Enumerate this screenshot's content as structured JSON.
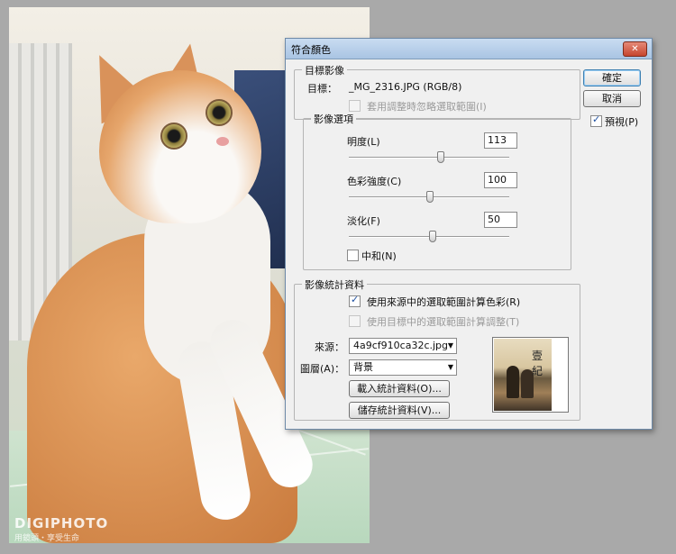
{
  "photo": {
    "watermark": "DIGIPHOTO",
    "watermark_sub": "用鏡頭・享受生命"
  },
  "dialog": {
    "title": "符合顏色",
    "close_glyph": "✕",
    "target_group": {
      "legend": "目標影像",
      "target_label": "目標：",
      "target_value": "_MG_2316.JPG (RGB/8)",
      "ignore_selection": {
        "label": "套用調整時忽略選取範圍(I)",
        "checked": false,
        "enabled": false
      }
    },
    "options_group": {
      "legend": "影像選項",
      "luminance": {
        "label": "明度(L)",
        "value": "113",
        "slider_fraction": 0.5
      },
      "color_intensity": {
        "label": "色彩強度(C)",
        "value": "100",
        "slider_fraction": 0.47
      },
      "fade": {
        "label": "淡化(F)",
        "value": "50",
        "slider_fraction": 0.5
      },
      "neutralize": {
        "label": "中和(N)",
        "checked": false
      }
    },
    "stats_group": {
      "legend": "影像統計資料",
      "use_source_selection": {
        "label": "使用來源中的選取範圍計算色彩(R)",
        "checked": true,
        "enabled": true
      },
      "use_target_selection": {
        "label": "使用目標中的選取範圍計算調整(T)",
        "checked": false,
        "enabled": false
      },
      "source": {
        "label": "來源：",
        "value": "4a9cf910ca32c.jpg"
      },
      "layer": {
        "label": "圖層(A)：",
        "value": "背景"
      },
      "load_button": "載入統計資料(O)...",
      "save_button": "儲存統計資料(V)..."
    },
    "buttons": {
      "ok": "確定",
      "cancel": "取消"
    },
    "preview": {
      "label": "預視(P)",
      "checked": true
    },
    "thumbnail_mark": "壹紀"
  },
  "colors": {
    "dialog_bg": "#f0f0f0",
    "titlebar": "#a9c4e3",
    "screen_bg": "#a9a9a9"
  }
}
